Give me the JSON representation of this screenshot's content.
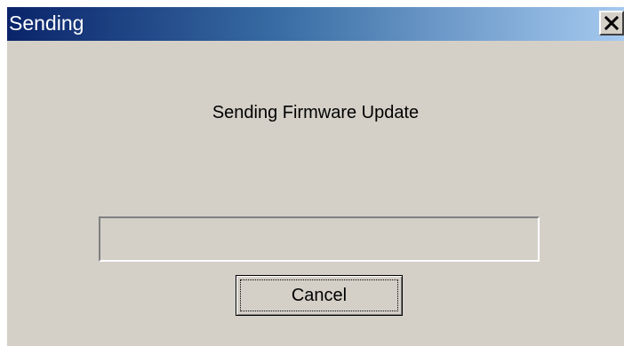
{
  "window": {
    "title": "Sending"
  },
  "dialog": {
    "message": "Sending Firmware Update",
    "progress_fraction": 0,
    "cancel_label": "Cancel"
  },
  "icons": {
    "close": "close-icon"
  },
  "colors": {
    "titlebar_start": "#0a246a",
    "titlebar_end": "#a6caf0",
    "dialog_face": "#d4d0c8"
  }
}
